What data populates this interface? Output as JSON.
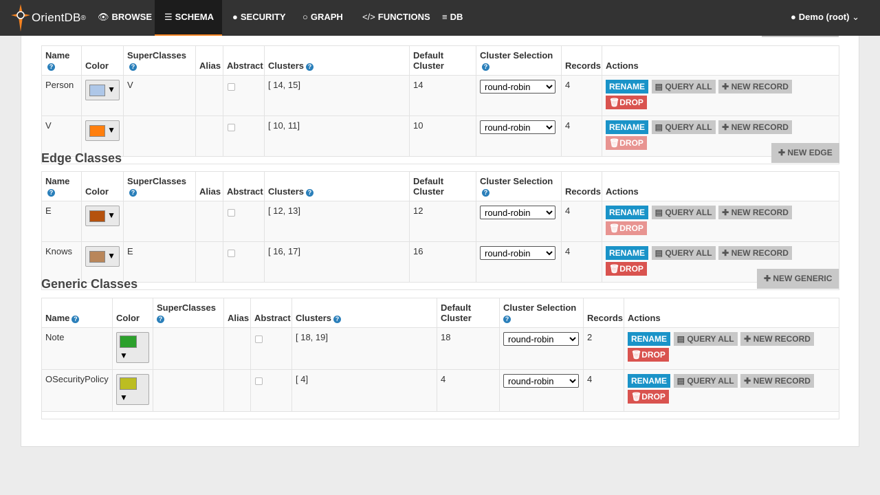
{
  "brand": {
    "name": "OrientDB",
    "tm": "®"
  },
  "nav": {
    "browse": "BROWSE",
    "schema": "SCHEMA",
    "security": "SECURITY",
    "graph": "GRAPH",
    "functions": "FUNCTIONS",
    "db": "DB",
    "user": "Demo (root)"
  },
  "headers": {
    "name": "Name",
    "color": "Color",
    "superclasses": "SuperClasses",
    "alias": "Alias",
    "abstract": "Abstract",
    "clusters": "Clusters",
    "default_cluster": "Default Cluster",
    "cluster_selection": "Cluster Selection",
    "records": "Records",
    "actions": "Actions"
  },
  "actions": {
    "rename": "RENAME",
    "query_all": "QUERY ALL",
    "new_record": "NEW RECORD",
    "drop": "DROP"
  },
  "vertex": {
    "rows": [
      {
        "name": "Person",
        "color": "#aec7e8",
        "superclasses": "V",
        "clusters": "[ 14, 15]",
        "default_cluster": "14",
        "selection": "round-robin",
        "records": "4"
      },
      {
        "name": "V",
        "color": "#ff7f0e",
        "superclasses": "",
        "clusters": "[ 10, 11]",
        "default_cluster": "10",
        "selection": "round-robin",
        "records": "4"
      }
    ]
  },
  "edge": {
    "title": "Edge Classes",
    "new_button": "NEW EDGE",
    "rows": [
      {
        "name": "E",
        "color": "#b5520e",
        "superclasses": "",
        "clusters": "[ 12, 13]",
        "default_cluster": "12",
        "selection": "round-robin",
        "records": "4"
      },
      {
        "name": "Knows",
        "color": "#b9865a",
        "superclasses": "E",
        "clusters": "[ 16, 17]",
        "default_cluster": "16",
        "selection": "round-robin",
        "records": "4"
      }
    ]
  },
  "generic": {
    "title": "Generic Classes",
    "new_button": "NEW GENERIC",
    "rows": [
      {
        "name": "Note",
        "color": "#2ca02c",
        "superclasses": "",
        "clusters": "[ 18, 19]",
        "default_cluster": "18",
        "selection": "round-robin",
        "records": "2"
      },
      {
        "name": "OSecurityPolicy",
        "color": "#bcbd22",
        "superclasses": "",
        "clusters": "[ 4]",
        "default_cluster": "4",
        "selection": "round-robin",
        "records": "4"
      }
    ]
  }
}
